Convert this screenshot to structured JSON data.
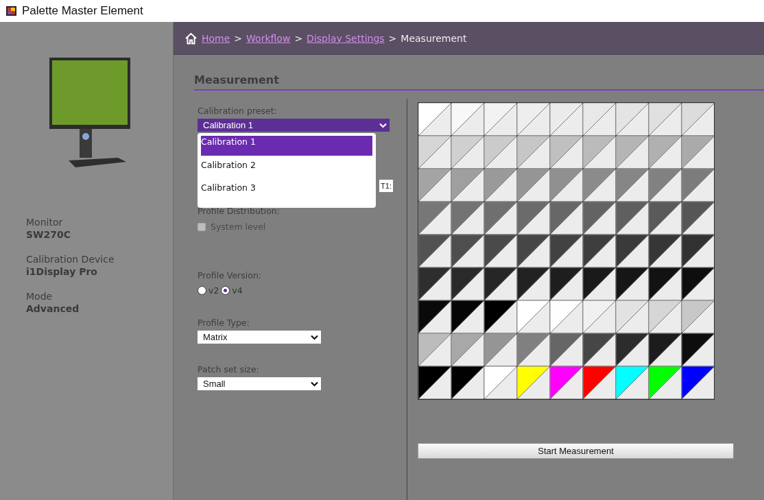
{
  "window": {
    "title": "Palette Master Element"
  },
  "sidebar": {
    "info": [
      {
        "label": "Monitor",
        "value": "SW270C"
      },
      {
        "label": "Calibration Device",
        "value": "i1Display Pro"
      },
      {
        "label": "Mode",
        "value": "Advanced"
      }
    ]
  },
  "breadcrumb": {
    "links": [
      "Home",
      "Workflow",
      "Display Settings"
    ],
    "separator": ">",
    "current": "Measurement"
  },
  "section": {
    "title": "Measurement"
  },
  "form": {
    "preset": {
      "label": "Calibration preset:",
      "value": "Calibration 1",
      "expanded": true,
      "options": [
        {
          "label": "Calibration 1",
          "selected": true
        },
        {
          "label": "Calibration 2",
          "selected": false
        },
        {
          "label": "Calibration 3",
          "selected": false
        }
      ]
    },
    "covered_field": {
      "value": "T1:"
    },
    "distribution": {
      "label": "Profile Distribution:",
      "option": "System level",
      "checked": false,
      "disabled": true
    },
    "version": {
      "label": "Profile Version:",
      "options": [
        {
          "label": "v2",
          "selected": false
        },
        {
          "label": "v4",
          "selected": true
        }
      ]
    },
    "type": {
      "label": "Profile Type:",
      "value": "Matrix"
    },
    "patch_size": {
      "label": "Patch set size:",
      "value": "Small"
    }
  },
  "patches": [
    {
      "cells": [
        {
          "color": "#ffffff"
        },
        {
          "color": "#f8f8f8"
        },
        {
          "color": "#f2f2f2"
        },
        {
          "color": "#eeeeee"
        },
        {
          "color": "#ebebeb"
        },
        {
          "color": "#e8e8e8"
        },
        {
          "color": "#e4e4e4"
        },
        {
          "color": "#e0e0e0"
        },
        {
          "color": "#dcdcdc"
        }
      ]
    },
    {
      "cells": [
        {
          "color": "#d6d6d6"
        },
        {
          "color": "#d0d0d0"
        },
        {
          "color": "#cbcbcb"
        },
        {
          "color": "#c6c6c6"
        },
        {
          "color": "#c0c0c0"
        },
        {
          "color": "#bbbbbb"
        },
        {
          "color": "#b5b5b5"
        },
        {
          "color": "#b0b0b0"
        },
        {
          "color": "#aaaaaa"
        }
      ]
    },
    {
      "cells": [
        {
          "color": "#a4a4a4"
        },
        {
          "color": "#9f9f9f"
        },
        {
          "color": "#9a9a9a"
        },
        {
          "color": "#959595"
        },
        {
          "color": "#909090"
        },
        {
          "color": "#8b8b8b"
        },
        {
          "color": "#868686"
        },
        {
          "color": "#818181"
        },
        {
          "color": "#7c7c7c"
        }
      ]
    },
    {
      "cells": [
        {
          "color": "#777777"
        },
        {
          "color": "#737373"
        },
        {
          "color": "#6f6f6f"
        },
        {
          "color": "#6b6b6b"
        },
        {
          "color": "#676767"
        },
        {
          "color": "#636363"
        },
        {
          "color": "#5f5f5f"
        },
        {
          "color": "#5a5a5a"
        },
        {
          "color": "#565656"
        }
      ]
    },
    {
      "cells": [
        {
          "color": "#525252"
        },
        {
          "color": "#4e4e4e"
        },
        {
          "color": "#4a4a4a"
        },
        {
          "color": "#464646"
        },
        {
          "color": "#424242"
        },
        {
          "color": "#3e3e3e"
        },
        {
          "color": "#3a3a3a"
        },
        {
          "color": "#363636"
        },
        {
          "color": "#323232"
        }
      ]
    },
    {
      "cells": [
        {
          "color": "#2e2e2e"
        },
        {
          "color": "#2a2a2a"
        },
        {
          "color": "#262626"
        },
        {
          "color": "#222222"
        },
        {
          "color": "#1e1e1e"
        },
        {
          "color": "#1a1a1a"
        },
        {
          "color": "#161616"
        },
        {
          "color": "#121212"
        },
        {
          "color": "#0e0e0e"
        }
      ]
    },
    {
      "cells": [
        {
          "color": "#0a0a0a"
        },
        {
          "color": "#050505"
        },
        {
          "color": "#000000"
        },
        {
          "color": "#ffffff"
        },
        {
          "color": "#fefefe"
        },
        {
          "color": "#f0f0f0"
        },
        {
          "color": "#e2e2e2"
        },
        {
          "color": "#d6d6d6"
        },
        {
          "color": "#c8c8c8"
        }
      ]
    },
    {
      "cells": [
        {
          "color": "#bcbcbc"
        },
        {
          "color": "#a8a8a8"
        },
        {
          "color": "#959595"
        },
        {
          "color": "#808080"
        },
        {
          "color": "#666666"
        },
        {
          "color": "#464646"
        },
        {
          "color": "#2c2c2c"
        },
        {
          "color": "#1c1c1c"
        },
        {
          "color": "#0d0d0d"
        }
      ]
    },
    {
      "cells": [
        {
          "color": "#000000"
        },
        {
          "color": "#010101"
        },
        {
          "color": "#ffffff"
        },
        {
          "color": "#ffff00"
        },
        {
          "color": "#ff00ff"
        },
        {
          "color": "#ff0000"
        },
        {
          "color": "#00ffff"
        },
        {
          "color": "#00ff00"
        },
        {
          "color": "#0000ff"
        }
      ]
    }
  ],
  "start_button": "Start Measurement"
}
